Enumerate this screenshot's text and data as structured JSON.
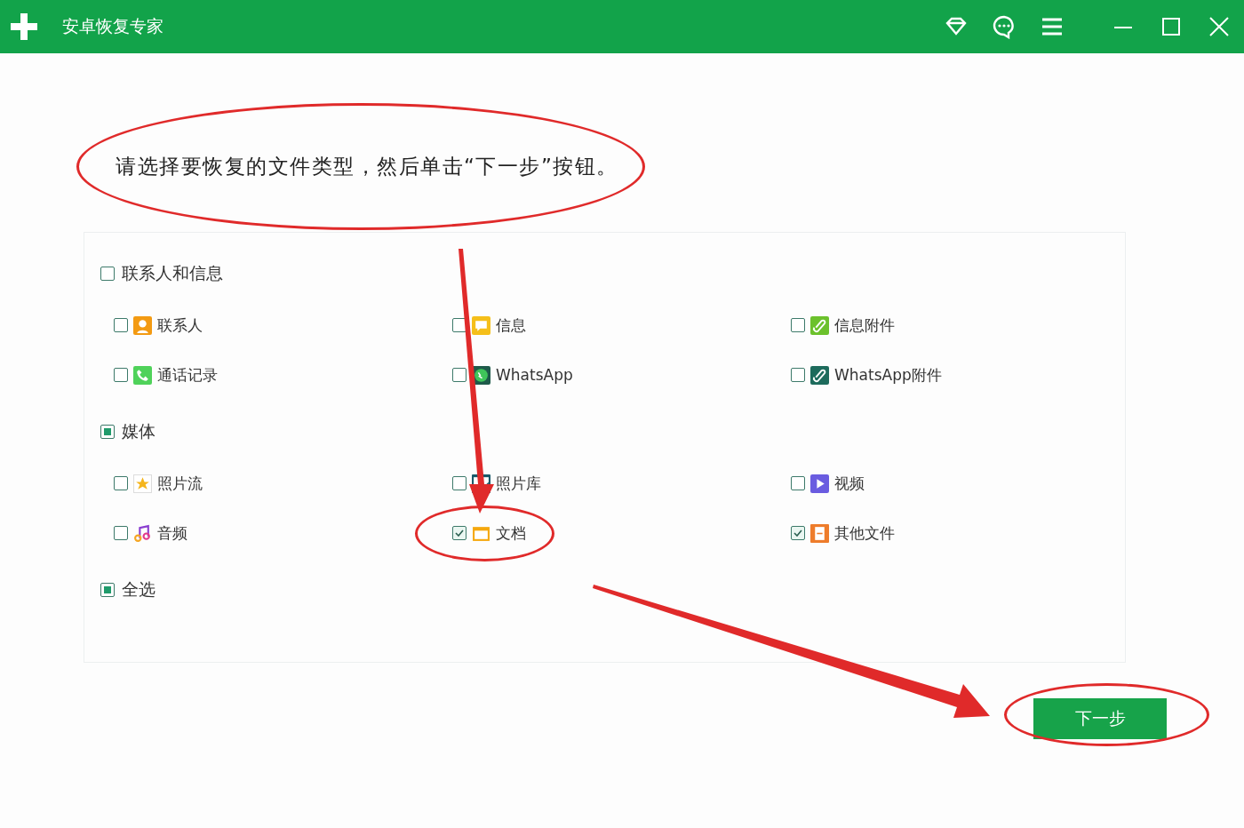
{
  "window": {
    "title": "安卓恢复专家"
  },
  "instruction": {
    "text": "请选择要恢复的文件类型，然后单击“下一步”按钮。",
    "highlighted": true
  },
  "groups": [
    {
      "label": "联系人和信息",
      "partial": false,
      "items": [
        {
          "label": "联系人",
          "checked": false,
          "highlighted": false
        },
        {
          "label": "信息",
          "checked": false,
          "highlighted": false
        },
        {
          "label": "信息附件",
          "checked": false,
          "highlighted": false
        },
        {
          "label": "通话记录",
          "checked": false,
          "highlighted": false
        },
        {
          "label": "WhatsApp",
          "checked": false,
          "highlighted": false
        },
        {
          "label": "WhatsApp附件",
          "checked": false,
          "highlighted": false
        }
      ]
    },
    {
      "label": "媒体",
      "partial": true,
      "items": [
        {
          "label": "照片流",
          "checked": false,
          "highlighted": false
        },
        {
          "label": "照片库",
          "checked": false,
          "highlighted": false
        },
        {
          "label": "视频",
          "checked": false,
          "highlighted": false
        },
        {
          "label": "音频",
          "checked": false,
          "highlighted": false
        },
        {
          "label": "文档",
          "checked": true,
          "highlighted": true
        },
        {
          "label": "其他文件",
          "checked": true,
          "highlighted": false
        }
      ]
    },
    {
      "label": "全选",
      "partial": true
    }
  ],
  "next_button": {
    "label": "下一步",
    "highlighted": true
  }
}
